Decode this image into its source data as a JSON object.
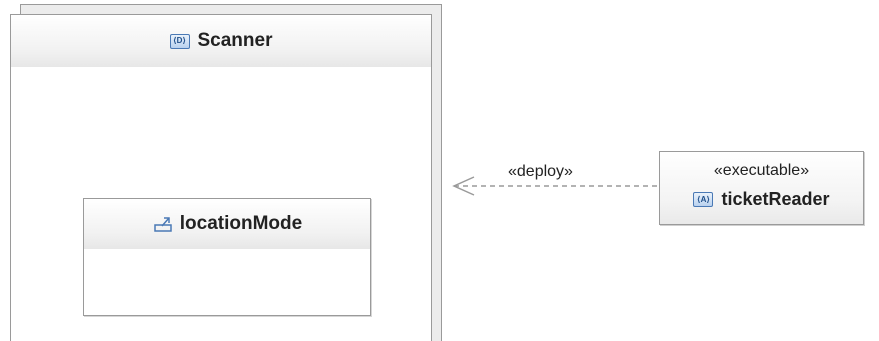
{
  "node": {
    "title": "Scanner",
    "icon": "node-icon"
  },
  "inner_element": {
    "title": "locationMode",
    "icon": "mode-icon"
  },
  "artifact": {
    "stereotype": "«executable»",
    "title": "ticketReader",
    "icon": "artifact-icon"
  },
  "connector": {
    "label": "«deploy»",
    "style": "dashed",
    "color": "#9a9a9a"
  },
  "colors": {
    "border": "#9a9a9a",
    "icon_blue": "#4a79b5",
    "header_gradient_end": "#e7e7e7"
  }
}
